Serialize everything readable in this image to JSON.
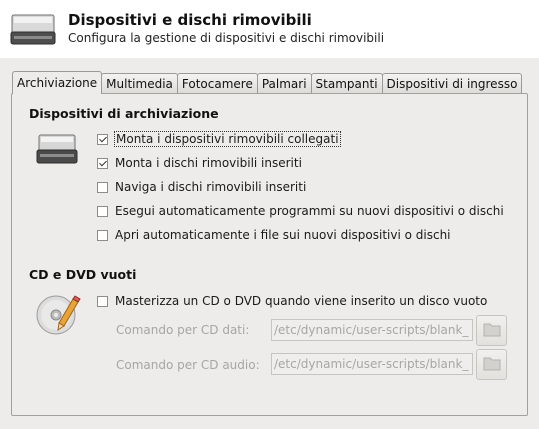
{
  "header": {
    "title": "Dispositivi e dischi rimovibili",
    "subtitle": "Configura la gestione di dispositivi e dischi rimovibili",
    "icon": "drive-icon"
  },
  "tabs": [
    {
      "label": "Archiviazione",
      "active": true
    },
    {
      "label": "Multimedia"
    },
    {
      "label": "Fotocamere"
    },
    {
      "label": "Palmari"
    },
    {
      "label": "Stampanti"
    },
    {
      "label": "Dispositivi di ingresso"
    }
  ],
  "storage": {
    "title": "Dispositivi di archiviazione",
    "icon": "drive-icon",
    "options": [
      {
        "label": "Monta i dispositivi rimovibili collegati",
        "checked": true
      },
      {
        "label": "Monta i dischi rimovibili inseriti",
        "checked": true
      },
      {
        "label": "Naviga i dischi rimovibili inseriti",
        "checked": false
      },
      {
        "label": "Esegui automaticamente programmi su nuovi dispositivi o dischi",
        "checked": false
      },
      {
        "label": "Apri automaticamente i file sui nuovi dispositivi o dischi",
        "checked": false
      }
    ]
  },
  "cd": {
    "title": "CD e DVD vuoti",
    "icon": "cd-burn-icon",
    "burn_label": "Masterizza un CD o DVD quando viene inserito un disco vuoto",
    "burn_checked": false,
    "data_label": "Comando per CD dati:",
    "data_value": "/etc/dynamic/user-scripts/blank_",
    "audio_label": "Comando per CD audio:",
    "audio_value": "/etc/dynamic/user-scripts/blank_"
  }
}
